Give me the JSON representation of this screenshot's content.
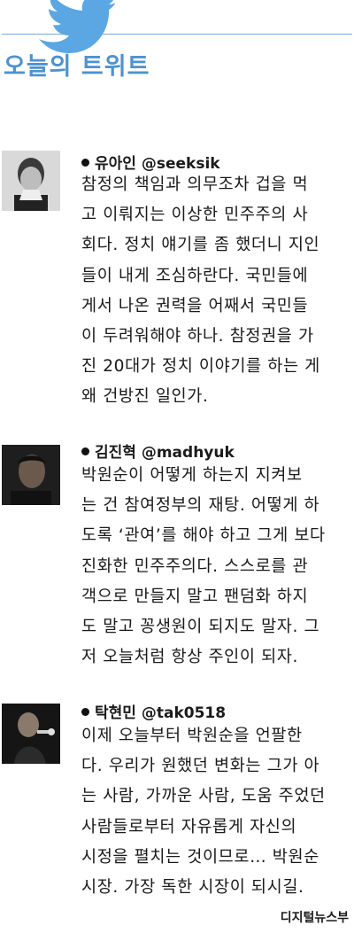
{
  "header": {
    "title": "오늘의 트위트",
    "bird_icon": "twitter-bird-icon",
    "accent": "#4b93d1"
  },
  "tweets": [
    {
      "name": "유아인",
      "handle": "@seeksik",
      "lines": [
        "참정의 책임과 의무조차 겁을 먹",
        "고 이뤄지는 이상한 민주주의 사",
        "회다. 정치 얘기를 좀 했더니 지인",
        "들이 내게 조심하란다. 국민들에",
        "게서 나온 권력을 어째서 국민들",
        "이 두려워해야 하나. 참정권을 가",
        "진 20대가 정치 이야기를 하는 게",
        "왜 건방진 일인가."
      ]
    },
    {
      "name": "김진혁",
      "handle": "@madhyuk",
      "lines": [
        "박원순이 어떻게 하는지 지켜보",
        "는 건 참여정부의 재탕. 어떻게 하",
        "도록 ‘관여’를 해야 하고 그게 보다",
        "진화한 민주주의다. 스스로를 관",
        "객으로 만들지 말고 팬덤화 하지",
        "도 말고 꽁생원이 되지도 말자. 그",
        "저 오늘처럼 항상 주인이 되자."
      ]
    },
    {
      "name": "탁현민",
      "handle": "@tak0518",
      "lines": [
        "이제 오늘부터 박원순을 언팔한",
        "다. 우리가 원했던 변화는 그가 아",
        "는 사람, 가까운 사람, 도움 주었던",
        "사람들로부터 자유롭게 자신의",
        "시정을 펼치는 것이므로… 박원순",
        "시장. 가장 독한 시장이 되시길."
      ]
    }
  ],
  "credit": "디지털뉴스부"
}
